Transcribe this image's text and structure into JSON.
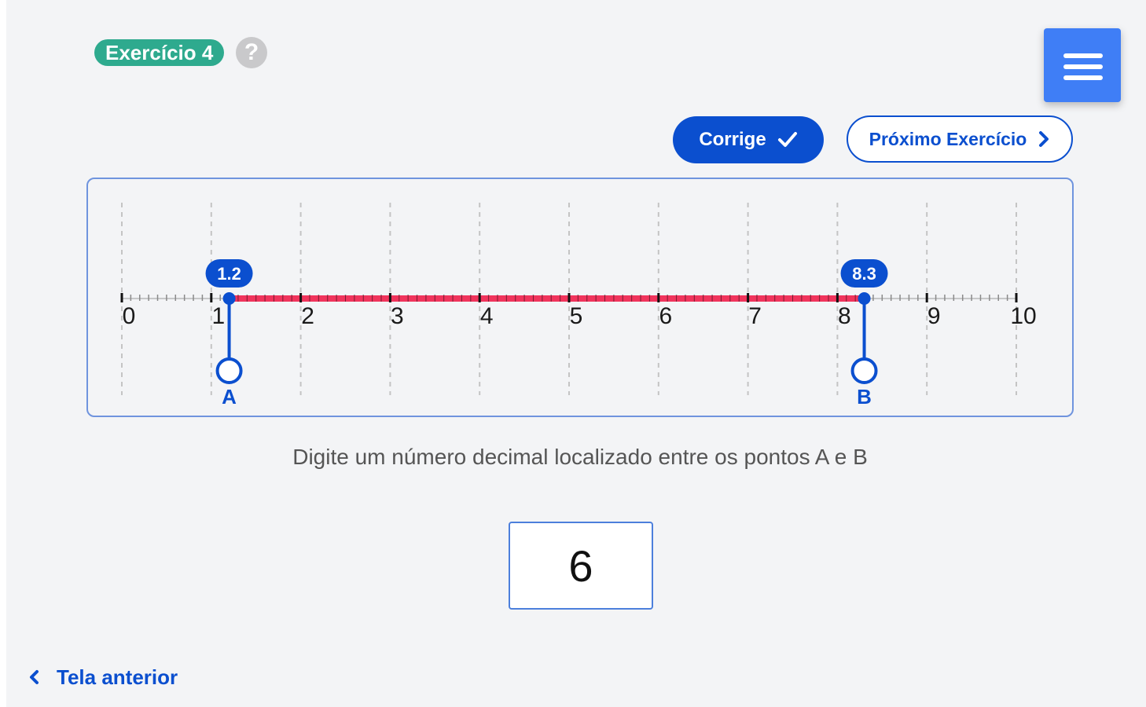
{
  "header": {
    "exercise_badge": "Exercício 4",
    "help_icon": "question-mark-icon",
    "menu_icon": "hamburger-menu-icon"
  },
  "actions": {
    "corrige_label": "Corrige",
    "corrige_icon": "check-icon",
    "next_label": "Próximo Exercício",
    "next_icon": "chevron-right-icon"
  },
  "number_line": {
    "min": 0,
    "max": 10,
    "tick_labels": [
      "0",
      "1",
      "2",
      "3",
      "4",
      "5",
      "6",
      "7",
      "8",
      "9",
      "10"
    ],
    "point_a": {
      "label": "A",
      "value": 1.2,
      "value_label": "1.2"
    },
    "point_b": {
      "label": "B",
      "value": 8.3,
      "value_label": "8.3"
    },
    "segment_color": "#f0345c",
    "point_color": "#0b4fcf"
  },
  "instruction": "Digite um número decimal localizado entre os pontos A e B",
  "answer": {
    "value": "6"
  },
  "footer": {
    "back_label": "Tela anterior",
    "back_icon": "chevron-left-icon"
  },
  "colors": {
    "badge": "#2eaa8e",
    "primary": "#0b4fcf",
    "menu": "#3f7ef6",
    "background": "#f3f4f6"
  }
}
